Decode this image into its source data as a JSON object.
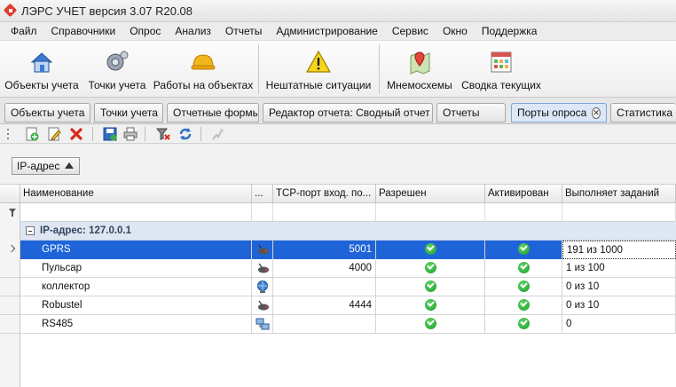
{
  "window": {
    "title": "ЛЭРС УЧЕТ версия 3.07 R20.08"
  },
  "menu": [
    "Файл",
    "Справочники",
    "Опрос",
    "Анализ",
    "Отчеты",
    "Администрирование",
    "Сервис",
    "Окно",
    "Поддержка"
  ],
  "ribbon": [
    {
      "label": "Объекты учета",
      "icon": "house-icon"
    },
    {
      "label": "Точки учета",
      "icon": "gear-meter-icon"
    },
    {
      "label": "Работы на объектах",
      "icon": "hard-hat-icon"
    },
    {
      "label": "Нештатные ситуации",
      "icon": "warning-icon"
    },
    {
      "label": "Мнемосхемы",
      "icon": "map-pin-icon"
    },
    {
      "label": "Сводка текущих",
      "icon": "calendar-grid-icon"
    }
  ],
  "tabs": [
    {
      "label": "Объекты учета"
    },
    {
      "label": "Точки учета"
    },
    {
      "label": "Отчетные формы"
    },
    {
      "label": "Редактор отчета: Сводный отчет по ХВ"
    },
    {
      "label": "Отчеты"
    },
    {
      "label": "Порты опроса",
      "active": true
    },
    {
      "label": "Статистика о"
    }
  ],
  "toolbar_icons": [
    "menu-grip-icon",
    "add-icon",
    "edit-icon",
    "delete-icon",
    "save-icon",
    "print-icon",
    "clear-filter-icon",
    "refresh-icon",
    "disconnect-icon"
  ],
  "group_by": {
    "label": "IP-адрес"
  },
  "columns": [
    "Наименование",
    "...",
    "TCP-порт вход. по...",
    "Разрешен",
    "Активирован",
    "Выполняет заданий"
  ],
  "group_row": {
    "label": "IP-адрес: 127.0.0.1"
  },
  "rows": [
    {
      "name": "GPRS",
      "icon": "modem-icon",
      "port": "5001",
      "enabled": true,
      "activated": true,
      "tasks": "191 из 1000",
      "selected": true
    },
    {
      "name": "Пульсар",
      "icon": "modem-icon",
      "port": "4000",
      "enabled": true,
      "activated": true,
      "tasks": "1 из 100"
    },
    {
      "name": "коллектор",
      "icon": "globe-icon",
      "port": "",
      "enabled": true,
      "activated": true,
      "tasks": "0 из 10"
    },
    {
      "name": "Robustel",
      "icon": "modem-icon",
      "port": "4444",
      "enabled": true,
      "activated": true,
      "tasks": "0 из 10"
    },
    {
      "name": "RS485",
      "icon": "network-icon",
      "port": "",
      "enabled": true,
      "activated": true,
      "tasks": "0"
    }
  ],
  "colors": {
    "selection": "#1e64d8",
    "group_row": "#dde6f2",
    "check": "#1c9a2a"
  }
}
